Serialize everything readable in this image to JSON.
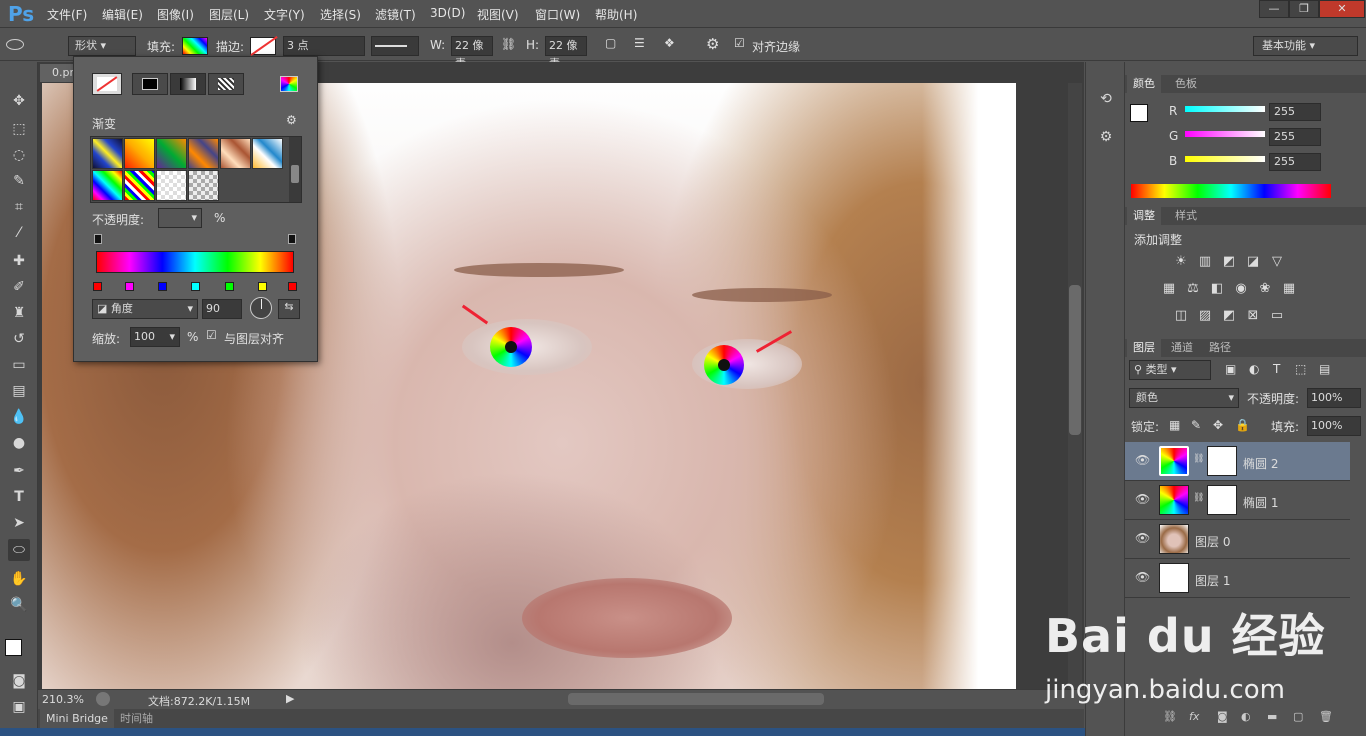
{
  "app": {
    "logo": "Ps"
  },
  "menu": [
    "文件(F)",
    "编辑(E)",
    "图像(I)",
    "图层(L)",
    "文字(Y)",
    "选择(S)",
    "滤镜(T)",
    "3D(D)",
    "视图(V)",
    "窗口(W)",
    "帮助(H)"
  ],
  "window_buttons": [
    "—",
    "❐",
    "✕"
  ],
  "options": {
    "mode": "形状",
    "fill_label": "填充:",
    "stroke_label": "描边:",
    "stroke_width": "3 点",
    "w_label": "W:",
    "w_value": "22 像素",
    "h_label": "H:",
    "h_value": "22 像素",
    "align_edges": "对齐边缘",
    "workspace": "基本功能"
  },
  "document": {
    "tab": "0.pn",
    "zoom": "210.3%",
    "doc_info": "文档:872.2K/1.15M"
  },
  "bottom_tabs": [
    "Mini Bridge",
    "时间轴"
  ],
  "gradient_panel": {
    "title": "渐变",
    "opacity_label": "不透明度:",
    "opacity_unit": "%",
    "style": "角度",
    "angle": "90",
    "scale_label": "缩放:",
    "scale_value": "100",
    "scale_unit": "%",
    "align_layer": "与图层对齐"
  },
  "color_panel": {
    "tabs": [
      "颜色",
      "色板"
    ],
    "r_label": "R",
    "g_label": "G",
    "b_label": "B",
    "r": "255",
    "g": "255",
    "b": "255"
  },
  "adjust_panel": {
    "tabs": [
      "调整",
      "样式"
    ],
    "title": "添加调整"
  },
  "layers_panel": {
    "tabs": [
      "图层",
      "通道",
      "路径"
    ],
    "filter": "类型",
    "blend": "颜色",
    "opacity_label": "不透明度:",
    "opacity": "100%",
    "lock_label": "锁定:",
    "fill_label": "填充:",
    "fill": "100%",
    "layers": [
      {
        "name": "椭圆 2",
        "selected": true
      },
      {
        "name": "椭圆 1",
        "selected": false
      },
      {
        "name": "图层 0",
        "selected": false
      },
      {
        "name": "图层 1",
        "selected": false
      }
    ]
  },
  "watermark": {
    "line1": "Bai du 经验",
    "line2": "jingyan.baidu.com"
  },
  "colors": {
    "accent": "#4fa2e8",
    "selected_layer": "#6b7a8f"
  }
}
